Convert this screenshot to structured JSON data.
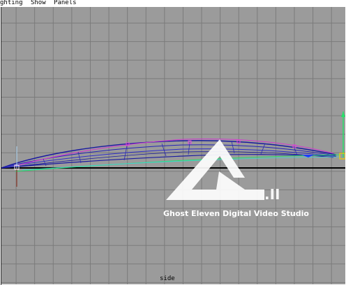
{
  "menu": {
    "items": [
      "ghting",
      "Show",
      "Panels"
    ]
  },
  "viewport": {
    "camera_label": "side",
    "background_color": "#9b9b9b",
    "grid_color": "#7a7a7a"
  },
  "watermark": {
    "badge": ".II",
    "text": "Ghost Eleven Digital Video Studio"
  },
  "icons": {
    "pivot": "pivot-handle-icon",
    "move_manipulator": "move-manipulator-icon"
  }
}
